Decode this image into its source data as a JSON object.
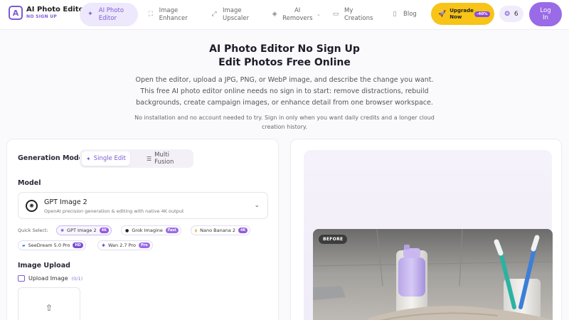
{
  "brand": {
    "logo_glyph": "A",
    "title": "AI Photo Editor",
    "subtitle": "NO SIGN UP"
  },
  "nav": {
    "items": [
      {
        "label": "AI Photo Editor",
        "icon": "magic-wand-icon",
        "active": true
      },
      {
        "label": "Image Enhancer",
        "icon": "enhance-icon",
        "active": false
      },
      {
        "label": "Image Upscaler",
        "icon": "upscale-icon",
        "active": false
      },
      {
        "label": "AI Removers",
        "icon": "eraser-icon",
        "active": false,
        "has_dropdown": true
      },
      {
        "label": "My Creations",
        "icon": "folder-icon",
        "active": false
      },
      {
        "label": "Blog",
        "icon": "book-icon",
        "active": false
      }
    ],
    "upgrade_label": "Upgrade Now",
    "upgrade_badge": "-40%",
    "credits": "6",
    "login_label": "Log In"
  },
  "hero": {
    "title_line1": "AI Photo Editor No Sign Up",
    "title_line2": "Edit Photos Free Online",
    "description": "Open the editor, upload a JPG, PNG, or WebP image, and describe the change you want. This free AI photo editor online needs no sign in to start: remove distractions, rebuild backgrounds, create campaign images, or enhance detail from one browser workspace.",
    "note": "No installation and no account needed to try. Sign in only when you want daily credits and a longer cloud creation history."
  },
  "editor": {
    "generation_mode_label": "Generation Mode",
    "modes": [
      {
        "label": "Single Edit",
        "active": true
      },
      {
        "label": "Multi Fusion",
        "active": false
      }
    ],
    "model_label": "Model",
    "model": {
      "name": "GPT Image 2",
      "description": "OpenAI precision generation & editing with native 4K output"
    },
    "quick_select_label": "Quick Select:",
    "quick_models": [
      {
        "name": "GPT Image 2",
        "badge": "4K",
        "badge_color": "#8e5be0",
        "selected": true
      },
      {
        "name": "Grok Imagine",
        "badge": "Fast",
        "badge_color": "#9a6be6",
        "selected": false
      },
      {
        "name": "Nano Banana 2",
        "badge": "4K",
        "badge_color": "#8e5be0",
        "selected": false
      },
      {
        "name": "SeeDream 5.0 Pro",
        "badge": "HD",
        "badge_color": "#7b4fd3",
        "selected": false
      },
      {
        "name": "Wan 2.7 Pro",
        "badge": "Pro",
        "badge_color": "#9a6be6",
        "selected": false
      }
    ],
    "image_upload_label": "Image Upload",
    "upload_image_label": "Upload Image",
    "upload_count": "(0/1)"
  },
  "preview": {
    "before_label": "BEFORE"
  },
  "colors": {
    "accent": "#7c5bd6",
    "upgrade": "#f7c417",
    "login": "#9a6be6"
  }
}
